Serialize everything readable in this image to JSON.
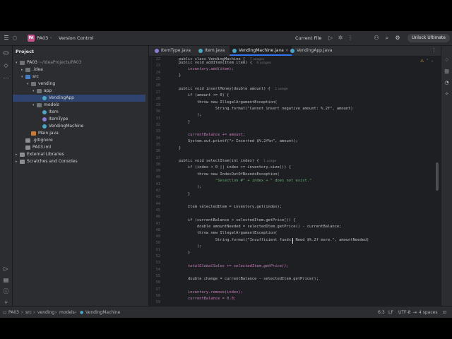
{
  "titlebar": {
    "project_badge": "PA",
    "project_name": "PA03",
    "vcs": "Version Control",
    "run_config": "Current File",
    "upgrade": "Unlock Ultimate"
  },
  "project_panel": {
    "title": "Project",
    "items": [
      {
        "label": "PA03",
        "extra": "~/IdeaProjects/PA03"
      },
      {
        "label": ".idea"
      },
      {
        "label": "src"
      },
      {
        "label": "vending"
      },
      {
        "label": "app"
      },
      {
        "label": "VendingApp"
      },
      {
        "label": "models"
      },
      {
        "label": "Item"
      },
      {
        "label": "ItemType"
      },
      {
        "label": "VendingMachine"
      },
      {
        "label": "Main.java"
      },
      {
        "label": ".gitignore"
      },
      {
        "label": "PA03.iml"
      },
      {
        "label": "External Libraries"
      },
      {
        "label": "Scratches and Consoles"
      }
    ]
  },
  "tabs": [
    {
      "label": "ItemType.java"
    },
    {
      "label": "Item.java"
    },
    {
      "label": "VendingMachine.java"
    },
    {
      "label": "VendingApp.java"
    }
  ],
  "line_numbers": [
    "22",
    "23",
    "24",
    "25",
    "26",
    "27",
    "28",
    "29",
    "30",
    "31",
    "32",
    "33",
    "34",
    "35",
    "36",
    "37",
    "38",
    "39",
    "40",
    "41",
    "42",
    "43",
    "44",
    "45",
    "46",
    "47",
    "48",
    "49",
    "50",
    "51",
    "52",
    "53",
    "54",
    "55",
    "56",
    "57",
    "58",
    "59",
    "60",
    "61",
    "62",
    "63",
    "64",
    "65",
    "66",
    "67",
    "68"
  ],
  "code": {
    "l0a": "public class VendingMachine {",
    "l0b": "7 usages",
    "l1a": "public void addItem(Item item) {",
    "l1b": "6 usages",
    "l2": "inventory.add(item);",
    "l3": "}",
    "l5a": "public void insertMoney(double amount) {",
    "l5b": "1 usage",
    "l6": "if (amount <= 0) {",
    "l7": "throw new IllegalArgumentException(",
    "l8": "String.format(\"Cannot insert negative amount: %.2f\", amount)",
    "l9": ");",
    "l10": "}",
    "l12": "currentBalance += amount;",
    "l13": "System.out.printf(\"> Inserted $%.2f%n\", amount);",
    "l14": "}",
    "l16a": "public void selectItem(int index) {",
    "l16b": "1 usage",
    "l17": "if (index < 0 || index >= inventory.size()) {",
    "l18": "throw new IndexOutOfBoundsException(",
    "l19": "\"Selection #\" + index + \" does not exist.\"",
    "l20": ");",
    "l21": "}",
    "l23": "Item selectedItem = inventory.get(index);",
    "l25": "if (currentBalance < selectedItem.getPrice()) {",
    "l26": "double amountNeeded = selectedItem.getPrice() - currentBalance;",
    "l27": "throw new IllegalArgumentException(",
    "l28": "String.format(\"Insufficient funds. Need $%.2f more.\", amountNeeded)",
    "l29": ");",
    "l30": "}",
    "l32": "totalGlobalSales += selectedItem.getPrice();",
    "l34": "double change = currentBalance - selectedItem.getPrice();",
    "l36": "inventory.remove(index);",
    "l37": "currentBalance = 0.0;"
  },
  "statusbar": {
    "crumbs": [
      "PA03",
      "src",
      "vending",
      "models",
      "VendingMachine"
    ],
    "position": "6:3",
    "line_sep": "LF",
    "encoding": "UTF-8",
    "indent": "4 spaces"
  },
  "colors": {
    "accent": "#3574f0",
    "badge": "#c6538c"
  }
}
